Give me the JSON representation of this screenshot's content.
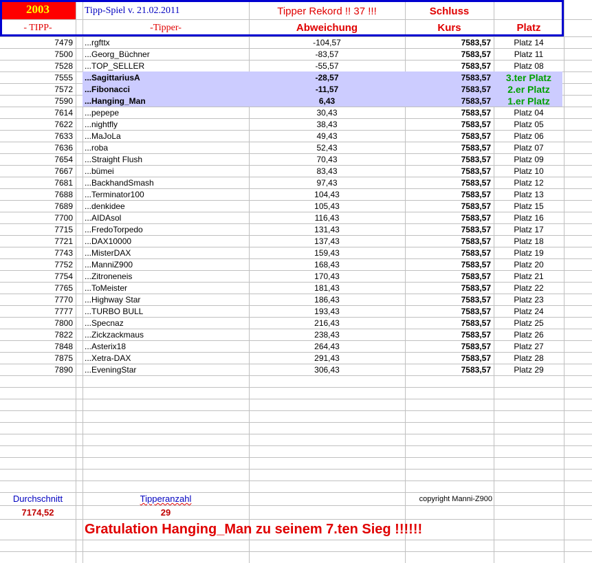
{
  "header": {
    "year": "2003",
    "title": "Tipp-Spiel v. 21.02.2011",
    "record": "Tipper Rekord !!  37  !!!",
    "schluss": "Schluss",
    "col_tipp": "- TIPP-",
    "col_tipper": "-Tipper-",
    "col_abweichung": "Abweichung",
    "col_kurs": "Kurs",
    "col_platz": "Platz"
  },
  "colors": {
    "year_bg": "#ff0000",
    "year_text": "#ffff00",
    "header_border": "#0000d0",
    "highlight": "#ccccff",
    "winner_green": "#00a000",
    "red": "#e00000",
    "blue": "#0000c0"
  },
  "rows": [
    {
      "tipp": "7479",
      "name": "...rgfttx",
      "abw": "-104,57",
      "kurs": "7583,57",
      "platz": "Platz 14"
    },
    {
      "tipp": "7500",
      "name": "...Georg_Büchner",
      "abw": "-83,57",
      "kurs": "7583,57",
      "platz": "Platz 11"
    },
    {
      "tipp": "7528",
      "name": "...TOP_SELLER",
      "abw": "-55,57",
      "kurs": "7583,57",
      "platz": "Platz 08"
    },
    {
      "tipp": "7555",
      "name": "...SagittariusA",
      "abw": "-28,57",
      "kurs": "7583,57",
      "platz": "3.ter Platz",
      "top": true
    },
    {
      "tipp": "7572",
      "name": "...Fibonacci",
      "abw": "-11,57",
      "kurs": "7583,57",
      "platz": "2.er Platz",
      "top": true
    },
    {
      "tipp": "7590",
      "name": "...Hanging_Man",
      "abw": "6,43",
      "kurs": "7583,57",
      "platz": "1.er Platz",
      "top": true
    },
    {
      "tipp": "7614",
      "name": "...pepepe",
      "abw": "30,43",
      "kurs": "7583,57",
      "platz": "Platz 04"
    },
    {
      "tipp": "7622",
      "name": "...nightfly",
      "abw": "38,43",
      "kurs": "7583,57",
      "platz": "Platz 05"
    },
    {
      "tipp": "7633",
      "name": "...MaJoLa",
      "abw": "49,43",
      "kurs": "7583,57",
      "platz": "Platz 06"
    },
    {
      "tipp": "7636",
      "name": "...roba",
      "abw": "52,43",
      "kurs": "7583,57",
      "platz": "Platz 07"
    },
    {
      "tipp": "7654",
      "name": "...Straight Flush",
      "abw": "70,43",
      "kurs": "7583,57",
      "platz": "Platz 09"
    },
    {
      "tipp": "7667",
      "name": "...bümei",
      "abw": "83,43",
      "kurs": "7583,57",
      "platz": "Platz 10"
    },
    {
      "tipp": "7681",
      "name": "...BackhandSmash",
      "abw": "97,43",
      "kurs": "7583,57",
      "platz": "Platz 12"
    },
    {
      "tipp": "7688",
      "name": "...Terminator100",
      "abw": "104,43",
      "kurs": "7583,57",
      "platz": "Platz 13"
    },
    {
      "tipp": "7689",
      "name": "...denkidee",
      "abw": "105,43",
      "kurs": "7583,57",
      "platz": "Platz 15"
    },
    {
      "tipp": "7700",
      "name": "...AIDAsol",
      "abw": "116,43",
      "kurs": "7583,57",
      "platz": "Platz 16"
    },
    {
      "tipp": "7715",
      "name": "...FredoTorpedo",
      "abw": "131,43",
      "kurs": "7583,57",
      "platz": "Platz 17"
    },
    {
      "tipp": "7721",
      "name": "...DAX10000",
      "abw": "137,43",
      "kurs": "7583,57",
      "platz": "Platz 18"
    },
    {
      "tipp": "7743",
      "name": "...MisterDAX",
      "abw": "159,43",
      "kurs": "7583,57",
      "platz": "Platz 19"
    },
    {
      "tipp": "7752",
      "name": "...ManniZ900",
      "abw": "168,43",
      "kurs": "7583,57",
      "platz": "Platz 20"
    },
    {
      "tipp": "7754",
      "name": "...Zitroneneis",
      "abw": "170,43",
      "kurs": "7583,57",
      "platz": "Platz 21"
    },
    {
      "tipp": "7765",
      "name": "...ToMeister",
      "abw": "181,43",
      "kurs": "7583,57",
      "platz": "Platz 22"
    },
    {
      "tipp": "7770",
      "name": "...Highway Star",
      "abw": "186,43",
      "kurs": "7583,57",
      "platz": "Platz 23"
    },
    {
      "tipp": "7777",
      "name": "...TURBO BULL",
      "abw": "193,43",
      "kurs": "7583,57",
      "platz": "Platz 24"
    },
    {
      "tipp": "7800",
      "name": "...Specnaz",
      "abw": "216,43",
      "kurs": "7583,57",
      "platz": "Platz 25"
    },
    {
      "tipp": "7822",
      "name": "...Zickzackmaus",
      "abw": "238,43",
      "kurs": "7583,57",
      "platz": "Platz 26"
    },
    {
      "tipp": "7848",
      "name": "...Asterix18",
      "abw": "264,43",
      "kurs": "7583,57",
      "platz": "Platz 27"
    },
    {
      "tipp": "7875",
      "name": "...Xetra-DAX",
      "abw": "291,43",
      "kurs": "7583,57",
      "platz": "Platz 28"
    },
    {
      "tipp": "7890",
      "name": "...EveningStar",
      "abw": "306,43",
      "kurs": "7583,57",
      "platz": "Platz 29"
    }
  ],
  "footer": {
    "avg_label": "Durchschnitt",
    "avg_value": "7174,52",
    "count_label": "Tipperanzahl",
    "count_value": "29",
    "copyright": "copyright Manni-Z900",
    "congrats": "Gratulation Hanging_Man  zu seinem 7.ten Sieg !!!!!!"
  }
}
